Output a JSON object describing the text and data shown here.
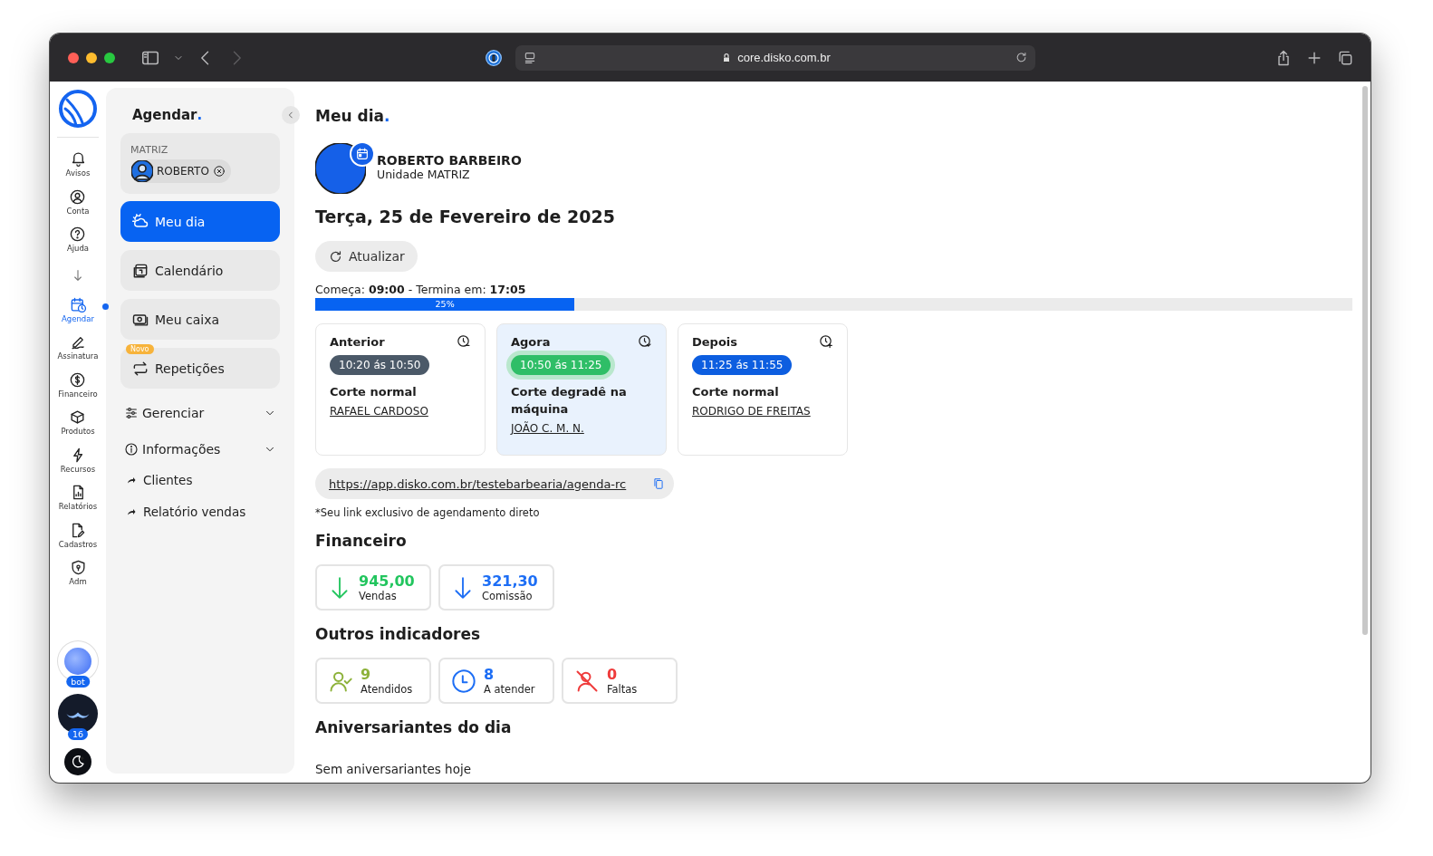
{
  "browser": {
    "url": "core.disko.com.br"
  },
  "rail": {
    "top_items": [
      {
        "label": "Avisos",
        "selected": false
      },
      {
        "label": "Conta",
        "selected": false
      },
      {
        "label": "Ajuda",
        "selected": false
      }
    ],
    "app_items": [
      {
        "label": "Agendar",
        "selected": true
      },
      {
        "label": "Assinatura",
        "selected": false
      },
      {
        "label": "Financeiro",
        "selected": false
      },
      {
        "label": "Produtos",
        "selected": false
      },
      {
        "label": "Recursos",
        "selected": false
      },
      {
        "label": "Relatórios",
        "selected": false
      },
      {
        "label": "Cadastros",
        "selected": false
      },
      {
        "label": "Adm",
        "selected": false
      }
    ],
    "bot_badge": "bot",
    "user_badge": "16"
  },
  "panel": {
    "title": "Agendar",
    "title_dot": ".",
    "unit_label": "MATRIZ",
    "chip": "ROBERTO",
    "nav": [
      {
        "label": "Meu dia",
        "selected": true
      },
      {
        "label": "Calendário",
        "selected": false
      },
      {
        "label": "Meu caixa",
        "selected": false
      },
      {
        "label": "Repetições",
        "selected": false,
        "badge": "Novo"
      }
    ],
    "sections": [
      {
        "label": "Gerenciar",
        "expanded": false
      },
      {
        "label": "Informações",
        "expanded": false
      }
    ],
    "links": [
      "Clientes",
      "Relatório vendas"
    ]
  },
  "main": {
    "title": "Meu dia",
    "title_dot": ".",
    "profile": {
      "name": "ROBERTO BARBEIRO",
      "unit": "Unidade MATRIZ"
    },
    "date": "Terça, 25 de Fevereiro de 2025",
    "refresh_button": "Atualizar",
    "schedule": {
      "start_label": "Começa:",
      "start": "09:00",
      "separator": "-",
      "end_label": "Termina em:",
      "end": "17:05",
      "level": 0.25,
      "reading": "25%"
    },
    "slots": [
      {
        "kind": "past",
        "heading": "Anterior",
        "time": "10:20 ás 10:50",
        "service": "Corte normal",
        "client": "RAFAEL CARDOSO",
        "selected": false
      },
      {
        "kind": "now",
        "heading": "Agora",
        "time": "10:50 ás 11:25",
        "service": "Corte degradê na máquina",
        "client": "JOÃO C. M. N.",
        "selected": true
      },
      {
        "kind": "next",
        "heading": "Depois",
        "time": "11:25 ás 11:55",
        "service": "Corte normal",
        "client": "RODRIGO DE FREITAS",
        "selected": false
      }
    ],
    "booking_link": "https://app.disko.com.br/testebarbearia/agenda-rc",
    "booking_note": "*Seu link exclusivo de agendamento direto",
    "finance_heading": "Financeiro",
    "finance": [
      {
        "value": "945,00",
        "label": "Vendas",
        "color": "#22c55e"
      },
      {
        "value": "321,30",
        "label": "Comissão",
        "color": "#1d6ef5"
      }
    ],
    "indicators_heading": "Outros indicadores",
    "indicators": [
      {
        "value": "9",
        "label": "Atendidos",
        "color": "#8db23a"
      },
      {
        "value": "8",
        "label": "A atender",
        "color": "#1d6ef5"
      },
      {
        "value": "0",
        "label": "Faltas",
        "color": "#ef3b3b"
      }
    ],
    "birthdays_heading": "Aniversariantes do dia",
    "birthdays_empty": "Sem aniversariantes hoje"
  }
}
